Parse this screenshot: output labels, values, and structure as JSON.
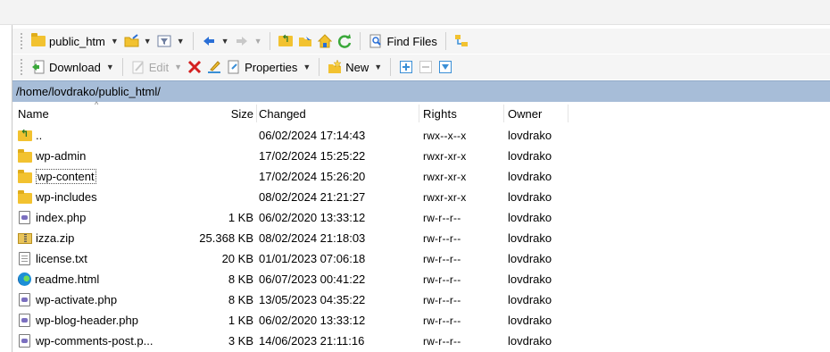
{
  "toolbar1": {
    "location_label": "public_htm",
    "find_files_label": "Find Files"
  },
  "toolbar2": {
    "download_label": "Download",
    "edit_label": "Edit",
    "properties_label": "Properties",
    "new_label": "New"
  },
  "path": "/home/lovdrako/public_html/",
  "columns": {
    "name": "Name",
    "size": "Size",
    "changed": "Changed",
    "rights": "Rights",
    "owner": "Owner"
  },
  "files": [
    {
      "name": "..",
      "size": "",
      "changed": "06/02/2024 17:14:43",
      "rights": "rwx--x--x",
      "owner": "lovdrako",
      "icon": "parent-folder-icon"
    },
    {
      "name": "wp-admin",
      "size": "",
      "changed": "17/02/2024 15:25:22",
      "rights": "rwxr-xr-x",
      "owner": "lovdrako",
      "icon": "folder-icon"
    },
    {
      "name": "wp-content",
      "size": "",
      "changed": "17/02/2024 15:26:20",
      "rights": "rwxr-xr-x",
      "owner": "lovdrako",
      "icon": "folder-icon"
    },
    {
      "name": "wp-includes",
      "size": "",
      "changed": "08/02/2024 21:21:27",
      "rights": "rwxr-xr-x",
      "owner": "lovdrako",
      "icon": "folder-icon"
    },
    {
      "name": "index.php",
      "size": "1 KB",
      "changed": "06/02/2020 13:33:12",
      "rights": "rw-r--r--",
      "owner": "lovdrako",
      "icon": "php-file-icon"
    },
    {
      "name": "izza.zip",
      "size": "25.368 KB",
      "changed": "08/02/2024 21:18:03",
      "rights": "rw-r--r--",
      "owner": "lovdrako",
      "icon": "zip-file-icon"
    },
    {
      "name": "license.txt",
      "size": "20 KB",
      "changed": "01/01/2023 07:06:18",
      "rights": "rw-r--r--",
      "owner": "lovdrako",
      "icon": "text-file-icon"
    },
    {
      "name": "readme.html",
      "size": "8 KB",
      "changed": "06/07/2023 00:41:22",
      "rights": "rw-r--r--",
      "owner": "lovdrako",
      "icon": "edge-html-icon"
    },
    {
      "name": "wp-activate.php",
      "size": "8 KB",
      "changed": "13/05/2023 04:35:22",
      "rights": "rw-r--r--",
      "owner": "lovdrako",
      "icon": "php-file-icon"
    },
    {
      "name": "wp-blog-header.php",
      "size": "1 KB",
      "changed": "06/02/2020 13:33:12",
      "rights": "rw-r--r--",
      "owner": "lovdrako",
      "icon": "php-file-icon"
    },
    {
      "name": "wp-comments-post.p...",
      "size": "3 KB",
      "changed": "14/06/2023 21:11:16",
      "rights": "rw-r--r--",
      "owner": "lovdrako",
      "icon": "php-file-icon"
    }
  ],
  "colors": {
    "path_bar": "#a7bdd8",
    "folder": "#f2c230",
    "delete_red": "#d42020",
    "nav_blue": "#2a6fd6",
    "refresh_green": "#3aa83a"
  }
}
